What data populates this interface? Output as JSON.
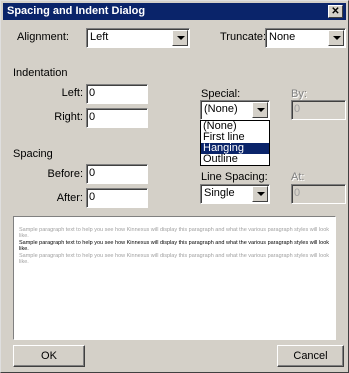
{
  "window": {
    "title": "Spacing and Indent Dialog",
    "close_glyph": "✕"
  },
  "alignment": {
    "label": "Alignment:",
    "value": "Left"
  },
  "truncate": {
    "label": "Truncate:",
    "value": "None"
  },
  "indentation": {
    "heading": "Indentation",
    "left_label": "Left:",
    "left_value": "0",
    "right_label": "Right:",
    "right_value": "0"
  },
  "special": {
    "label": "Special:",
    "value": "(None)",
    "options": [
      "(None)",
      "First line",
      "Hanging",
      "Outline"
    ],
    "highlighted_index": 2
  },
  "by": {
    "label": "By:",
    "value": "0"
  },
  "spacing": {
    "heading": "Spacing",
    "before_label": "Before:",
    "before_value": "0",
    "after_label": "After:",
    "after_value": "0"
  },
  "line_spacing": {
    "label": "Line Spacing:",
    "value": "Single"
  },
  "at": {
    "label": "At:",
    "value": "0"
  },
  "preview": {
    "para1": "Sample paragraph text to help you see how Kinnexus will display this paragraph and what the various paragraph styles will look like.",
    "para2": "Sample paragraph text to help you see how Kinnexus will display this paragraph and what the various paragraph styles will look like.",
    "para3": "Sample paragraph text to help you see how Kinnexus will display this paragraph and what the various paragraph styles will look like."
  },
  "buttons": {
    "ok": "OK",
    "cancel": "Cancel"
  }
}
